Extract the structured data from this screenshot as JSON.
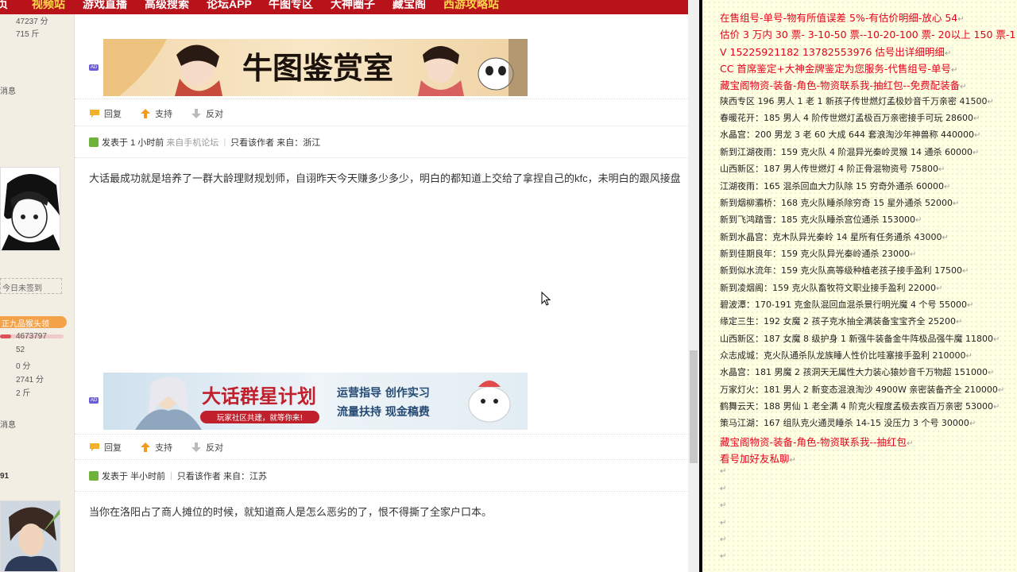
{
  "nav": {
    "items": [
      "页",
      "视频站",
      "游戏直播",
      "高级搜索",
      "论坛APP",
      "牛图专区",
      "大神圈子",
      "藏宝阁",
      "西游攻略站"
    ]
  },
  "sidebar": {
    "top_stats": [
      "47237 分",
      "715 斤"
    ],
    "msg1": "消息",
    "signin": "今日未签到",
    "rank": "正九品猴头领",
    "stats": [
      "4673797",
      "52",
      "0 分",
      "2741 分",
      "2 斤"
    ],
    "msg2": "消息",
    "num": "91"
  },
  "posts": [
    {
      "banner_text": "牛图鉴赏室",
      "ad_tag": "AD",
      "actions": [
        "回复",
        "支持",
        "反对"
      ],
      "meta_prefix": "发表于",
      "meta_time": "1 小时前",
      "meta_source": "来自手机论坛",
      "meta_author_only": "只看该作者",
      "meta_from": "来自：浙江",
      "text": "大话最成功就是培养了一群大龄理财规划师，自诩昨天今天赚多少多少，明白的都知道上交给了拿捏自己的kfc，未明白的跟风接盘"
    },
    {
      "banner_title": "大话群星计划",
      "banner_sub": "玩家社区共建，就等你来!",
      "banner_r1": "运营指导  创作实习",
      "banner_r2": "流量扶持  现金稿费",
      "ad_tag": "AD",
      "actions": [
        "回复",
        "支持",
        "反对"
      ],
      "meta_prefix": "发表于",
      "meta_time": "半小时前",
      "meta_author_only": "只看该作者",
      "meta_from": "来自：江苏",
      "text": "当你在洛阳占了商人摊位的时候，就知道商人是怎么恶劣的了，恨不得撕了全家户口本。"
    }
  ],
  "notepad": {
    "lines": [
      {
        "text": "在售组号-单号-物有所值误差 5%-有估价明细-放心    54",
        "style": "red"
      },
      {
        "text": "估价 3 万内 30 票- 3-10-50 票--10-20-100 票- 20以上 150 票-1 票 1元",
        "style": "red"
      },
      {
        "text": "V 15225921182     13782553976    估号出详细明细",
        "style": "red"
      },
      {
        "text": "CC 首席鉴定+大神金牌鉴定为您服务-代售组号-单号",
        "style": "red"
      },
      {
        "text": "藏宝阁物资-装备-角色-物资联系我-抽红包--免费配装备",
        "style": "red"
      },
      {
        "text": "陕西专区 196 男人 1 老 1 新孩子传世燃灯孟极妙音千万亲密 41500",
        "style": "blk"
      },
      {
        "text": "春暖花开：185 男人 4 阶传世燃灯孟极百万亲密接手可玩 28600",
        "style": "blk"
      },
      {
        "text": "水晶宫：200 男龙 3 老 60 大成 644 套浪淘沙年神兽称 440000",
        "style": "blk"
      },
      {
        "text": "新到江湖夜雨：159 克火队 4 阶混异光秦岭灵猴 14 通杀 60000",
        "style": "blk"
      },
      {
        "text": "山西新区：187 男人传世燃灯 4 阶正骨混物资号 75800",
        "style": "blk"
      },
      {
        "text": "江湖夜雨：165 混杀回血大力队除 15 穷奇外通杀 60000",
        "style": "blk"
      },
      {
        "text": "新到烟柳灞桥：168 克火队睡杀除穷奇 15 星外通杀 52000",
        "style": "blk"
      },
      {
        "text": "新到飞鸿踏雪：185 克火队睡杀宫位通杀 153000",
        "style": "blk"
      },
      {
        "text": "新到水晶宫：克木队异光秦岭 14 星所有任务通杀 43000",
        "style": "blk"
      },
      {
        "text": "新到佳期良年：159 克火队异光秦岭通杀 23000",
        "style": "blk"
      },
      {
        "text": "新到似水流年：159 克火队高等级种植老孩子接手盈利 17500",
        "style": "blk"
      },
      {
        "text": "新到凌烟阁：159 克火队畜牧符文职业接手盈利 22000",
        "style": "blk"
      },
      {
        "text": "碧波潭：170-191 克金队混回血混杀景行明光魔 4 个号 55000",
        "style": "blk"
      },
      {
        "text": "缘定三生：192 女魔 2 孩子克水抽全满装备宝宝齐全 25200",
        "style": "blk"
      },
      {
        "text": "山西新区：187 女魔 8 级护身 1 新强牛装备金牛阵极品强牛魔 11800",
        "style": "blk"
      },
      {
        "text": "众志成城：克火队通杀队龙族睡人性价比哇塞接手盈利 210000",
        "style": "blk"
      },
      {
        "text": "水晶宫：181 男魔 2 孩洞天无属性大力装心猿妙音千万物超 151000",
        "style": "blk"
      },
      {
        "text": "万家灯火：181 男人 2 新变态混浪淘沙 4900W 亲密装备齐全 210000",
        "style": "blk"
      },
      {
        "text": "鹤舞云天：188 男仙 1 老全满 4 阶克火程度孟极去疾百万亲密 53000",
        "style": "blk"
      },
      {
        "text": "策马江湖：167 组队克火通灵睡杀 14-15 没压力 3 个号 30000",
        "style": "blk"
      },
      {
        "text": "藏宝阁物资-装备-角色-物资联系我--抽红包",
        "style": "red"
      },
      {
        "text": "看号加好友私聊",
        "style": "red"
      },
      {
        "text": "",
        "style": "empty"
      },
      {
        "text": "",
        "style": "empty"
      },
      {
        "text": "",
        "style": "empty"
      },
      {
        "text": "",
        "style": "empty"
      },
      {
        "text": "",
        "style": "empty"
      },
      {
        "text": "",
        "style": "empty"
      }
    ]
  },
  "colors": {
    "nav_bg": "#b8121b",
    "note_red": "#e6001a",
    "note_bg": "#ffffe3"
  }
}
